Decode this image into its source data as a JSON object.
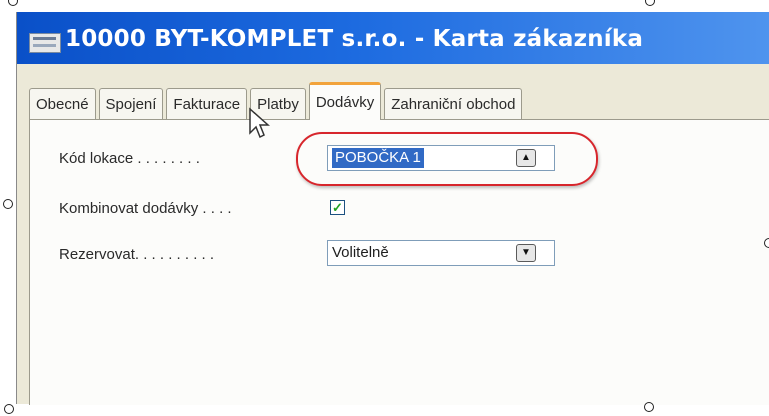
{
  "window": {
    "title": "10000 BYT-KOMPLET s.r.o. - Karta zákazníka",
    "icon": "card-icon"
  },
  "tabs": [
    {
      "label": "Obecné",
      "active": false
    },
    {
      "label": "Spojení",
      "active": false
    },
    {
      "label": "Fakturace",
      "active": false
    },
    {
      "label": "Platby",
      "active": false
    },
    {
      "label": "Dodávky",
      "active": true
    },
    {
      "label": "Zahraniční obchod",
      "active": false
    }
  ],
  "form": {
    "location": {
      "label": "Kód lokace . . . . . . . .",
      "value": "POBOČKA 1",
      "button_icon": "lookup-arrow-icon"
    },
    "combine": {
      "label": "Kombinovat dodávky . . . .",
      "checked": true
    },
    "reserve": {
      "label": "Rezervovat. . . . . . . . . .",
      "value": "Volitelně",
      "button_icon": "dropdown-arrow-icon"
    }
  },
  "colors": {
    "title_bar": "#0a50c8",
    "active_tab_accent": "#f2a33b",
    "selection": "#316ac5",
    "highlight_ellipse": "#d7262c",
    "checkmark": "#21a121"
  }
}
